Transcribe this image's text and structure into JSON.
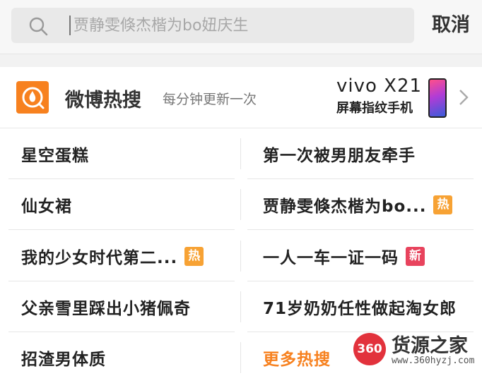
{
  "search": {
    "placeholder": "贾静雯倏杰楷为bo妞庆生",
    "cancel_label": "取消"
  },
  "weibo": {
    "title": "微博热搜",
    "subtitle": "每分钟更新一次",
    "ad_brand": "vivo X21",
    "ad_model": "屏幕指纹手机"
  },
  "hot_items": [
    {
      "label": "星空蛋糕",
      "badge": ""
    },
    {
      "label": "第一次被男朋友牵手",
      "badge": ""
    },
    {
      "label": "仙女裙",
      "badge": ""
    },
    {
      "label": "贾静雯倏杰楷为bo...",
      "badge": "热"
    },
    {
      "label": "我的少女时代第二...",
      "badge": "热"
    },
    {
      "label": "一人一车一证一码",
      "badge": "新"
    },
    {
      "label": "父亲雪里踩出小猪佩奇",
      "badge": ""
    },
    {
      "label": "71岁奶奶任性做起淘女郎",
      "badge": ""
    },
    {
      "label": "招渣男体质",
      "badge": ""
    },
    {
      "label": "更多热搜",
      "badge": ""
    }
  ],
  "colors": {
    "hot_badge": "#f7a234",
    "new_badge": "#e8435d",
    "accent_orange": "#f7811f"
  },
  "watermark": {
    "logo_text": "360",
    "title": "货源之家",
    "url": "www.360hyzj.com"
  }
}
